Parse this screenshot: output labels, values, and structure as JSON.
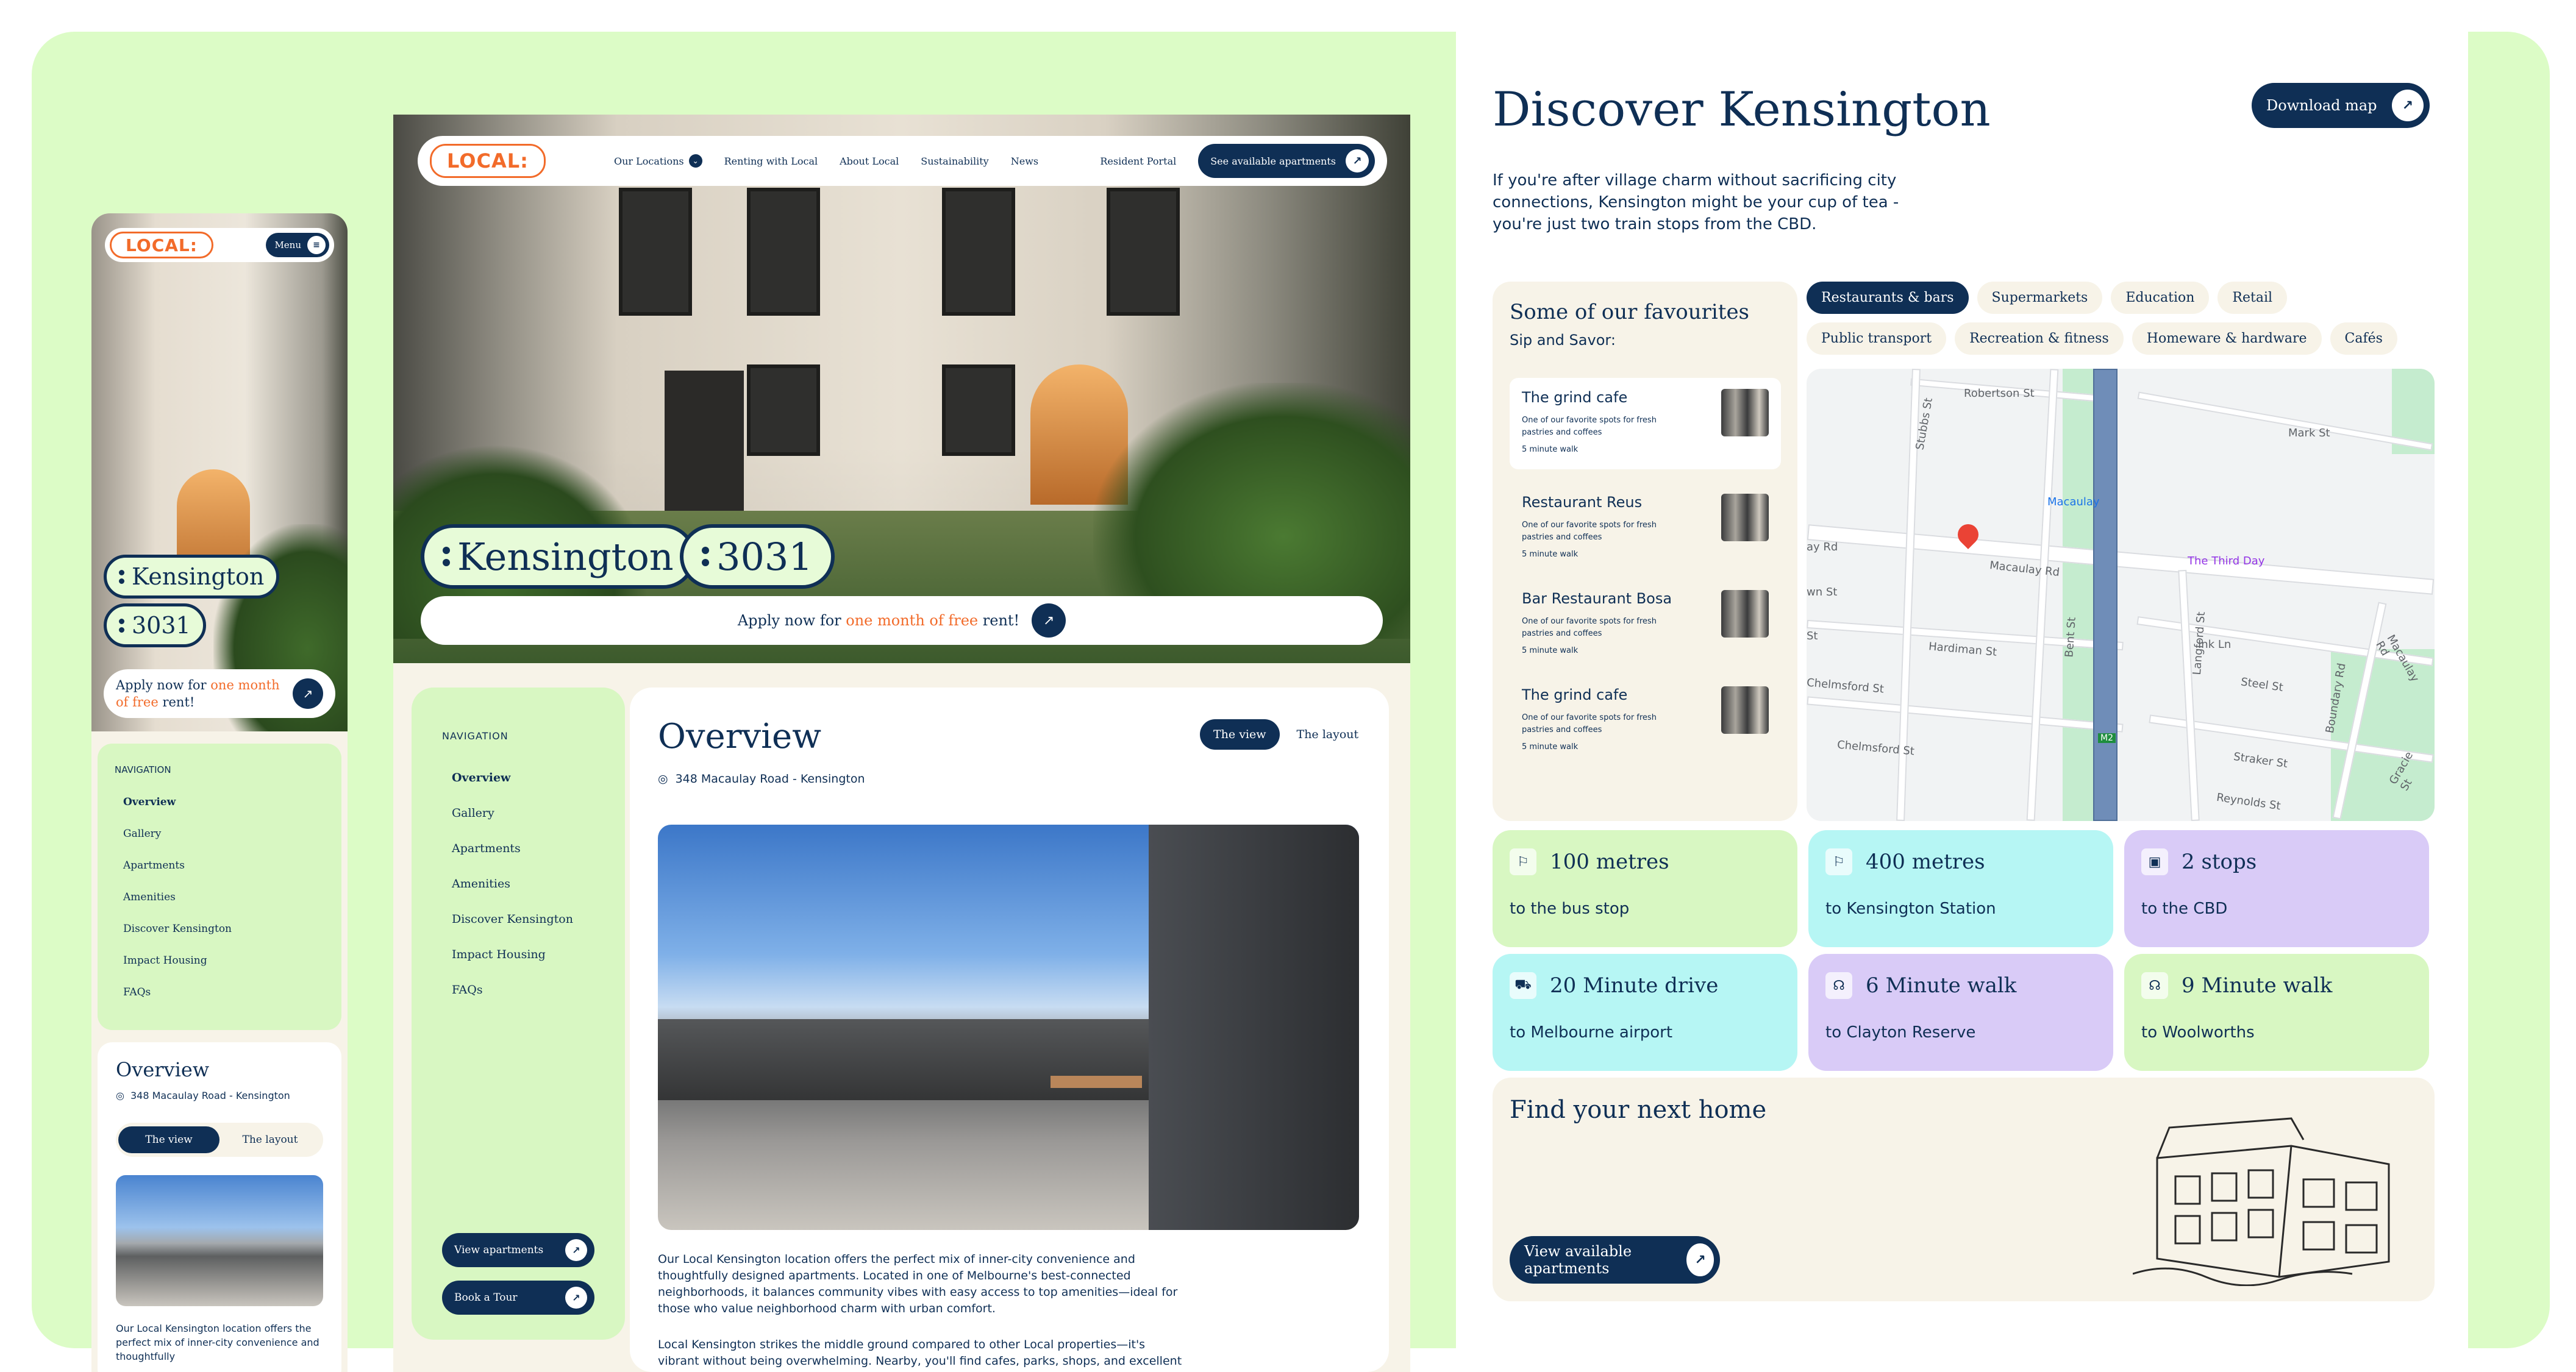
{
  "brand": {
    "logo_text": "LOCAL:"
  },
  "desktop": {
    "nav": {
      "items": [
        "Our Locations",
        "Renting with Local",
        "About Local",
        "Sustainability",
        "News"
      ],
      "resident_portal": "Resident Portal",
      "cta": "See available apartments"
    },
    "tags": {
      "suburb": "Kensington",
      "postcode": "3031"
    },
    "apply": {
      "prefix": "Apply now for",
      "highlight": "one month of free",
      "suffix": "rent!"
    },
    "sidenav": {
      "heading": "NAVIGATION",
      "items": [
        "Overview",
        "Gallery",
        "Apartments",
        "Amenities",
        "Discover Kensington",
        "Impact Housing",
        "FAQs"
      ],
      "view_apartments": "View apartments",
      "book_tour": "Book a Tour"
    },
    "overview": {
      "title": "Overview",
      "address": "348 Macaulay Road - Kensington",
      "toggle_view": "The view",
      "toggle_layout": "The layout",
      "para1": "Our Local Kensington location offers the perfect mix of inner-city convenience and thoughtfully designed apartments. Located in one of Melbourne's best-connected neighborhoods, it balances community vibes with easy access to top amenities—ideal for those who value neighborhood charm with urban comfort.",
      "para2": "Local Kensington strikes the middle ground compared to other Local properties—it's vibrant without being overwhelming. Nearby, you'll find cafes, parks, shops, and excellent public"
    }
  },
  "mobile": {
    "menu_label": "Menu",
    "tags": {
      "suburb": "Kensington",
      "postcode": "3031"
    },
    "apply": {
      "prefix": "Apply now for",
      "highlight1": "one month",
      "highlight2": "of free",
      "suffix": "rent!"
    },
    "sidenav": {
      "heading": "NAVIGATION",
      "items": [
        "Overview",
        "Gallery",
        "Apartments",
        "Amenities",
        "Discover Kensington",
        "Impact Housing",
        "FAQs"
      ]
    },
    "overview": {
      "title": "Overview",
      "address": "348 Macaulay Road - Kensington",
      "toggle_view": "The view",
      "toggle_layout": "The layout",
      "para": "Our Local Kensington location offers the perfect mix of inner-city convenience and thoughtfully"
    }
  },
  "discover": {
    "title": "Discover Kensington",
    "intro": "If you're after village charm without sacrificing city connections, Kensington might be your cup of tea - you're just two train stops from the CBD.",
    "download_map": "Download map",
    "favourites": {
      "title": "Some of our favourites",
      "subtitle": "Sip and Savor:",
      "items": [
        {
          "name": "The grind cafe",
          "desc": "One of our favorite spots for fresh pastries and coffees",
          "walk": "5 minute walk"
        },
        {
          "name": "Restaurant Reus",
          "desc": "One of our favorite spots for fresh pastries and coffees",
          "walk": "5 minute walk"
        },
        {
          "name": "Bar Restaurant Bosa",
          "desc": "One of our favorite spots for fresh pastries and coffees",
          "walk": "5 minute walk"
        },
        {
          "name": "The grind cafe",
          "desc": "One of our favorite spots for fresh pastries and coffees",
          "walk": "5 minute walk"
        }
      ]
    },
    "chips": [
      "Restaurants & bars",
      "Supermarkets",
      "Education",
      "Retail",
      "Public transport",
      "Recreation & fitness",
      "Homeware & hardware",
      "Cafés"
    ],
    "map_labels": {
      "robertson": "Robertson St",
      "stubbs": "Stubbs St",
      "mark": "Mark St",
      "macaulay_station": "Macaulay",
      "third_day": "The Third Day",
      "macaulay_rd": "Macaulay Rd",
      "bay": "ay Rd",
      "hardiman": "Hardiman St",
      "chelmsford": "Chelmsford St",
      "chelmsford2": "Chelmsford St",
      "bent": "Bent St",
      "langford": "Langford St",
      "ink": "Ink Ln",
      "steel": "Steel St",
      "boundary": "Boundary Rd",
      "macaulay_rd2": "Macaulay Rd",
      "straker": "Straker St",
      "reynolds": "Reynolds St",
      "gracie": "Gracie St",
      "m2": "M2",
      "wn": "wn St",
      "st": "St"
    },
    "stats": [
      {
        "icon": "flag-icon",
        "value": "100 metres",
        "label": "to the bus stop",
        "color": "lime"
      },
      {
        "icon": "flag-icon",
        "value": "400 metres",
        "label": "to Kensington Station",
        "color": "cyan"
      },
      {
        "icon": "train-icon",
        "value": "2 stops",
        "label": "to the CBD",
        "color": "lav"
      },
      {
        "icon": "car-icon",
        "value": "20 Minute drive",
        "label": "to Melbourne airport",
        "color": "cyan"
      },
      {
        "icon": "walk-icon",
        "value": "6 Minute walk",
        "label": "to Clayton Reserve",
        "color": "lav"
      },
      {
        "icon": "walk-icon",
        "value": "9 Minute walk",
        "label": "to Woolworths",
        "color": "lime"
      }
    ],
    "find_home": {
      "title": "Find your next home",
      "cta": "View available apartments"
    }
  },
  "colors": {
    "navy": "#0f2f55",
    "orange": "#f26b2a",
    "green_bg": "#dcfcc6",
    "cream": "#f7f3e8",
    "cyan": "#b6f6f4",
    "lavender": "#d9cbf7"
  }
}
